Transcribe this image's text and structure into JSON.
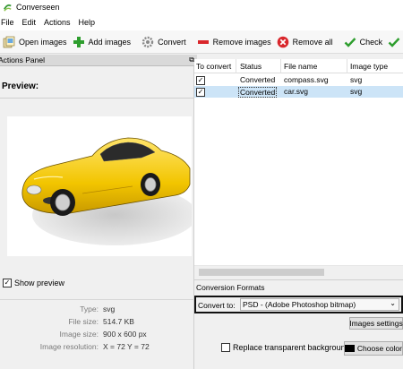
{
  "app": {
    "title": "Converseen"
  },
  "menu": [
    "File",
    "Edit",
    "Actions",
    "Help"
  ],
  "toolbar": {
    "open_images": "Open images",
    "add_images": "Add images",
    "convert": "Convert",
    "remove_images": "Remove images",
    "remove_all": "Remove all",
    "check": "Check"
  },
  "actions_panel": {
    "title": "Actions Panel",
    "float_icon": "⧉",
    "preview_label": "Preview:",
    "show_preview_label": "Show preview",
    "show_preview_checked": true
  },
  "image_info": {
    "type_label": "Type:",
    "type_value": "svg",
    "file_size_label": "File size:",
    "file_size_value": "514.7 KB",
    "image_size_label": "Image size:",
    "image_size_value": "900 x 600 px",
    "resolution_label": "Image resolution:",
    "resolution_value": "X = 72 Y = 72"
  },
  "table": {
    "columns": [
      "To convert",
      "Status",
      "File name",
      "Image type"
    ],
    "rows": [
      {
        "checked": true,
        "status": "Converted",
        "file_name": "compass.svg",
        "image_type": "svg",
        "selected": false
      },
      {
        "checked": true,
        "status": "Converted",
        "file_name": "car.svg",
        "image_type": "svg",
        "selected": true
      }
    ]
  },
  "conversion": {
    "section_label": "Conversion Formats",
    "convert_to_label": "Convert to:",
    "convert_to_value": "PSD - (Adobe Photoshop bitmap)",
    "images_settings_label": "Images settings",
    "replace_transparent_label": "Replace transparent background",
    "replace_transparent_checked": false,
    "choose_color_label": "Choose color"
  },
  "colors": {
    "selection": "#cce4f7",
    "car_yellow": "#f2c500",
    "add_green": "#2e9e2e",
    "remove_red": "#d9262b"
  },
  "icons": {
    "open": "folder-images-icon",
    "add": "plus-icon",
    "convert": "gear-icon",
    "remove": "minus-icon",
    "remove_all": "x-circle-icon",
    "check": "checkmark-icon"
  }
}
